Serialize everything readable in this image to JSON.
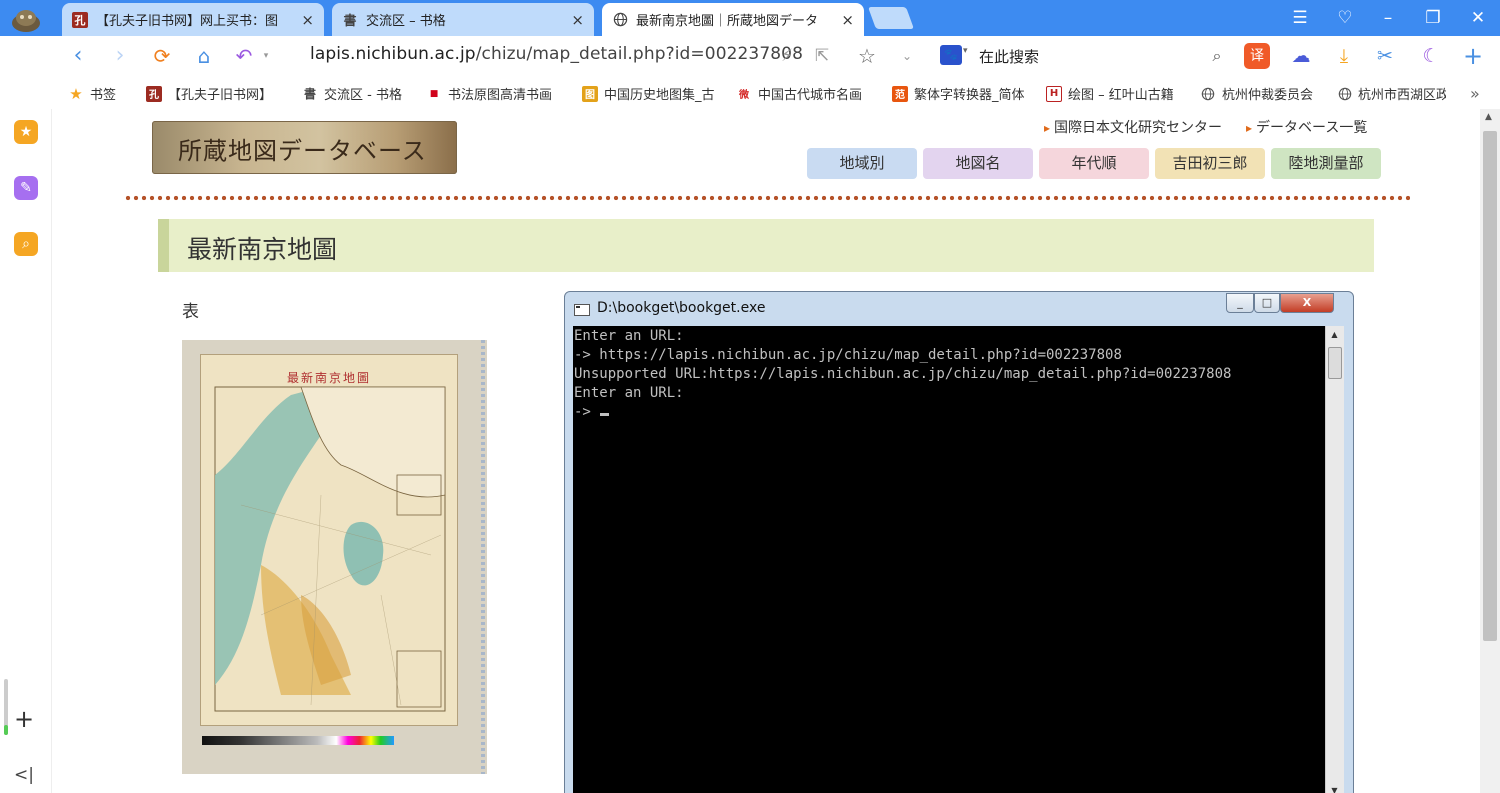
{
  "tabs": [
    {
      "favicon": "孔",
      "title": "【孔夫子旧书网】网上买书：图",
      "close": "×"
    },
    {
      "favicon": "書",
      "title": "交流区 – 书格",
      "close": "×"
    },
    {
      "favicon": "globe",
      "title": "最新南京地圖｜所蔵地図データ",
      "close": "×",
      "active": true
    }
  ],
  "window_controls": {
    "menu": "☰",
    "skin": "♡",
    "minimize": "–",
    "restore": "❐",
    "close": "✕"
  },
  "address_bar": {
    "host": "lapis.nichibun.ac.jp",
    "path": "/chizu/map_detail.php?id=002237808"
  },
  "search": {
    "engine_icon": "paw-icon",
    "label": "在此搜索"
  },
  "bookmarks": [
    {
      "icon": "★",
      "label": "书签"
    },
    {
      "icon": "孔",
      "label": "【孔夫子旧书网】"
    },
    {
      "icon": "書",
      "label": "交流区 - 书格"
    },
    {
      "icon": "■",
      "label": "书法原图高清书画"
    },
    {
      "icon": "图",
      "label": "中国历史地图集_古"
    },
    {
      "icon": "微",
      "label": "中国古代城市名画"
    },
    {
      "icon": "范",
      "label": "繁体字转换器_简体"
    },
    {
      "icon": "H",
      "label": "绘图 – 红叶山古籍"
    },
    {
      "icon": "globe",
      "label": "杭州仲裁委员会"
    },
    {
      "icon": "globe",
      "label": "杭州市西湖区政"
    }
  ],
  "bookmarks_more": "»",
  "site": {
    "logo_text": "所蔵地図データベース",
    "top_links": [
      "国際日本文化研究センター",
      "データベース一覧"
    ],
    "categories": [
      "地域別",
      "地図名",
      "年代順",
      "吉田初三郎",
      "陸地測量部"
    ],
    "page_title": "最新南京地圖",
    "side_label": "表",
    "map_caption": "最新南京地圖"
  },
  "console": {
    "title": "D:\\bookget\\bookget.exe",
    "lines": [
      "Enter an URL:",
      "-> https://lapis.nichibun.ac.jp/chizu/map_detail.php?id=002237808",
      "Unsupported URL:https://lapis.nichibun.ac.jp/chizu/map_detail.php?id=002237808",
      "Enter an URL:",
      "-> "
    ],
    "buttons": {
      "minimize": "_",
      "maximize": "□",
      "close": "X"
    }
  },
  "colors": {
    "tabbar": "#3d8bf1",
    "cat_region": "#c9dbf2",
    "cat_name": "#e3d4ef",
    "cat_era": "#f5d6dc",
    "cat_yoshida": "#f2e2b5",
    "cat_survey": "#cfe5c2",
    "title_bg": "#e8efc9",
    "dots": "#b5532a"
  }
}
